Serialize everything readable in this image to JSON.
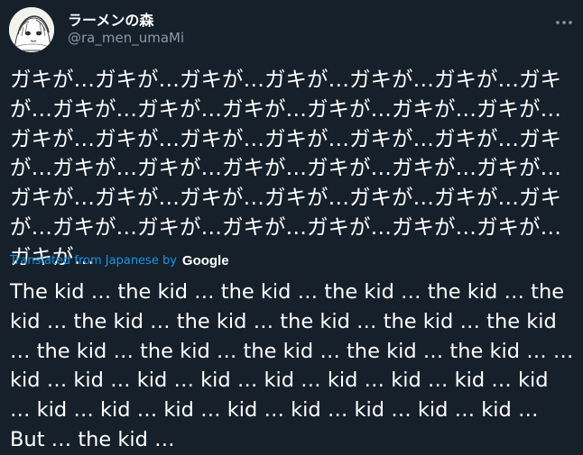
{
  "tweet": {
    "author": {
      "display_name": "ラーメンの森",
      "handle": "@ra_men_umaMi",
      "avatar_icon": "avatar-drawing-icon"
    },
    "more_icon": "more-horizontal-icon",
    "text": "ガキが…ガキが…ガキが…ガキが…ガキが…ガキが…ガキが…ガキが…ガキが…ガキが…ガキが…ガキが…ガキが…ガキが…ガキが…ガキが…ガキが…ガキが…ガキが…ガキが…ガキが…ガキが…ガキが…ガキが…ガキが…ガキが…ガキが…ガキが…ガキが…ガキが…ガキが…ガキが…ガキが…ガキが…ガキが…ガキが…ガキが…ガキが…ガキが…ガキが…",
    "translation": {
      "label": "Translated from Japanese by",
      "provider": "Google",
      "text": "The kid … the kid … the kid … the kid … the kid … the kid … the kid … the kid … the kid … the kid … the kid … the kid … the kid … the kid … the kid … the kid … … kid … kid … kid … kid … kid … kid … kid … kid … kid … kid … kid … kid … kid … kid … kid … kid … kid … But … the kid …"
    }
  },
  "colors": {
    "background": "#15202b",
    "primary_text": "#ffffff",
    "secondary_text": "#8899a6",
    "link": "#1b95e0"
  }
}
